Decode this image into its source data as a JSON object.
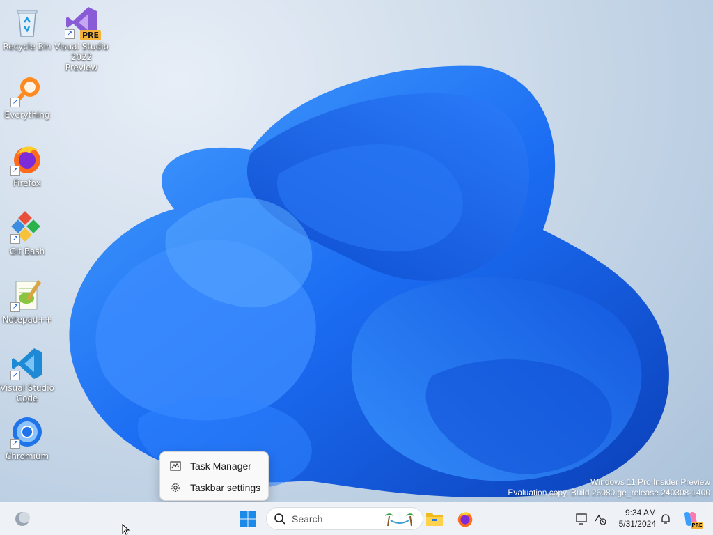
{
  "desktop": {
    "icons": [
      {
        "label": "Recycle Bin",
        "icon": "recycle-bin-icon"
      },
      {
        "label": "Visual Studio 2022 Preview",
        "icon": "visual-studio-preview-icon",
        "badge": "PRE"
      },
      {
        "label": "Everything",
        "icon": "everything-search-icon"
      },
      {
        "label": "Firefox",
        "icon": "firefox-icon"
      },
      {
        "label": "Git Bash",
        "icon": "git-bash-icon"
      },
      {
        "label": "Notepad++",
        "icon": "notepad-plus-plus-icon"
      },
      {
        "label": "Visual Studio Code",
        "icon": "vscode-icon"
      },
      {
        "label": "Chromium",
        "icon": "chromium-icon"
      }
    ]
  },
  "watermark": {
    "line1": "Windows 11 Pro Insider Preview",
    "line2": "Evaluation copy. Build 26080.ge_release.240308-1400"
  },
  "context_menu": {
    "items": [
      {
        "label": "Task Manager",
        "icon": "task-manager-icon"
      },
      {
        "label": "Taskbar settings",
        "icon": "gear-icon"
      }
    ]
  },
  "taskbar": {
    "search_placeholder": "Search",
    "time": "9:34 AM",
    "date": "5/31/2024",
    "copilot_badge": "PRE"
  },
  "colors": {
    "accent": "#0067c0",
    "bloom": "#1a6cf0",
    "taskbar_bg": "#eef2f7"
  }
}
